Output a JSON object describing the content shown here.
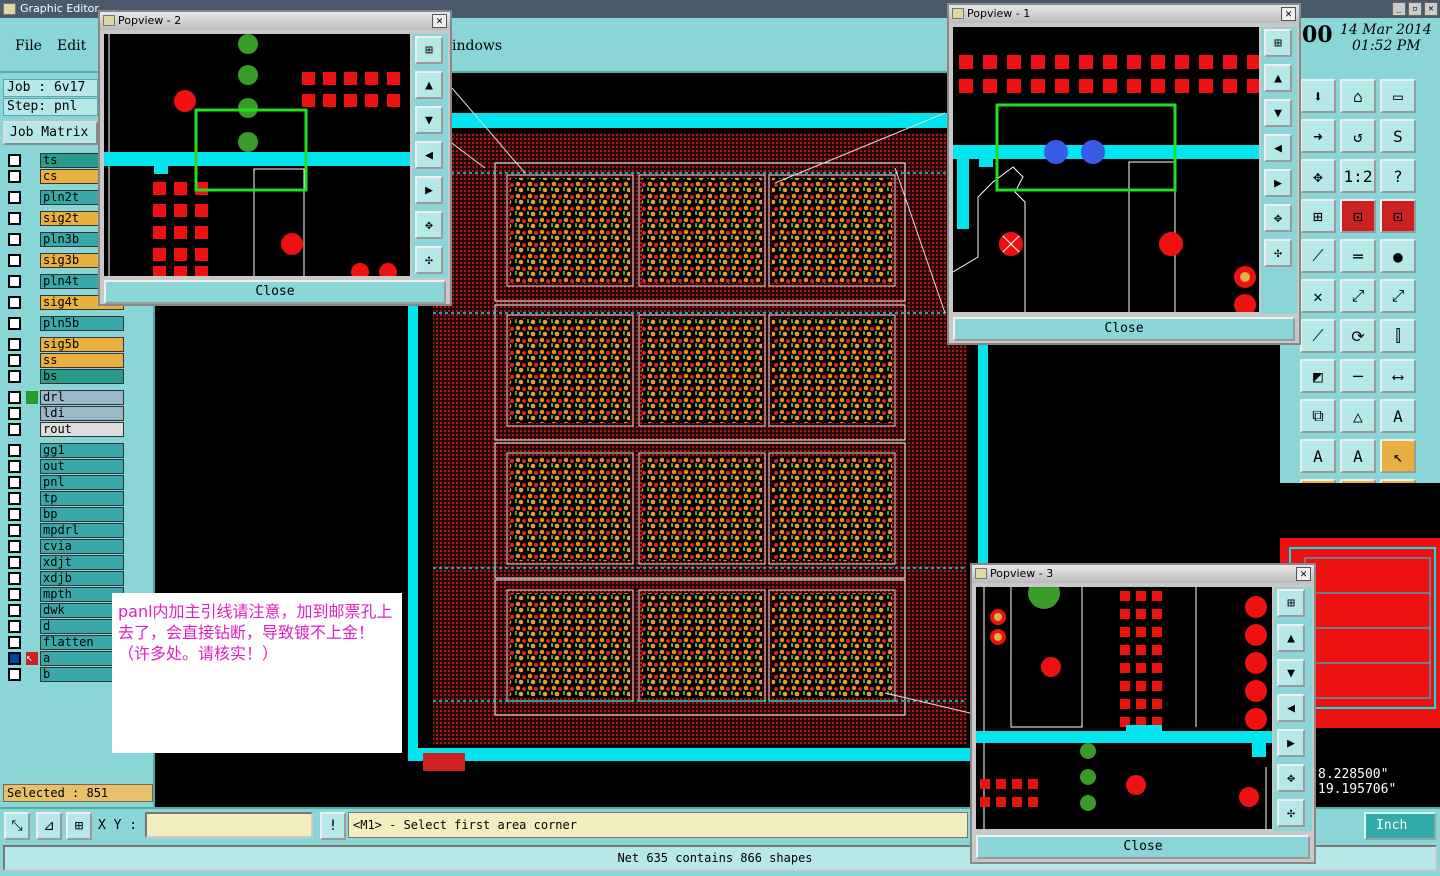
{
  "window": {
    "title": "Graphic Editor"
  },
  "menu": {
    "file": "File",
    "edit": "Edit",
    "windows": "indows"
  },
  "clock": {
    "date": "14 Mar 2014",
    "time": "01:52 PM",
    "partial": "00"
  },
  "job": {
    "job_label": "Job : 6v17",
    "step_label": "Step: pnl",
    "matrix_button": "Job Matrix"
  },
  "layers": [
    {
      "name": "ts",
      "color": "#2a9a8a"
    },
    {
      "name": "cs",
      "color": "#e8b040"
    },
    {
      "name": "pln2t",
      "color": "#3aa8a8"
    },
    {
      "name": "sig2t",
      "color": "#e8b040"
    },
    {
      "name": "pln3b",
      "color": "#3aa8a8"
    },
    {
      "name": "sig3b",
      "color": "#e8b040"
    },
    {
      "name": "pln4t",
      "color": "#3aa8a8"
    },
    {
      "name": "sig4t",
      "color": "#e8b040"
    },
    {
      "name": "pln5b",
      "color": "#3aa8a8"
    },
    {
      "name": "sig5b",
      "color": "#e8b040"
    },
    {
      "name": "ss",
      "color": "#e8b040"
    },
    {
      "name": "bs",
      "color": "#2a9a8a"
    },
    {
      "name": "drl",
      "color": "#9ab8c8"
    },
    {
      "name": "ldi",
      "color": "#9ab8c8"
    },
    {
      "name": "rout",
      "color": "#dcdcdc"
    },
    {
      "name": "gg1",
      "color": "#3aa8a8"
    },
    {
      "name": "out",
      "color": "#3aa8a8"
    },
    {
      "name": "pnl",
      "color": "#3aa8a8"
    },
    {
      "name": "tp",
      "color": "#3aa8a8"
    },
    {
      "name": "bp",
      "color": "#3aa8a8"
    },
    {
      "name": "mpdrl",
      "color": "#3aa8a8"
    },
    {
      "name": "cvia",
      "color": "#3aa8a8"
    },
    {
      "name": "xdjt",
      "color": "#3aa8a8"
    },
    {
      "name": "xdjb",
      "color": "#3aa8a8"
    },
    {
      "name": "mpth",
      "color": "#3aa8a8"
    },
    {
      "name": "dwk",
      "color": "#3aa8a8"
    },
    {
      "name": "d",
      "color": "#3aa8a8"
    },
    {
      "name": "flatten",
      "color": "#3aa8a8"
    },
    {
      "name": "a",
      "color": "#3aa8a8"
    },
    {
      "name": "b",
      "color": "#3aa8a8"
    }
  ],
  "selected": "Selected : 851",
  "note_text": "panl内加主引线请注意，加到邮票孔上去了，会直接钻断，导致镀不上金！（许多处。请核实！）",
  "popviews": {
    "p1": {
      "title": "Popview - 1",
      "close": "Close"
    },
    "p2": {
      "title": "Popview - 2",
      "close": "Close"
    },
    "p3": {
      "title": "Popview - 3",
      "close": "Close"
    }
  },
  "coords": {
    "x": "8.228500\"",
    "y": "19.195706\""
  },
  "bottom": {
    "xy_label": "X Y :",
    "xy_value": "",
    "prompt": "<M1> - Select first area corner",
    "unit": "Inch"
  },
  "status": "Net 635 contains 866 shapes",
  "colors": {
    "panel": "#8ad6d6",
    "cyan_trace": "#00e5ee",
    "pad_red": "#ee1111",
    "pad_green": "#3a9a2a",
    "highlight": "#22dd22"
  }
}
